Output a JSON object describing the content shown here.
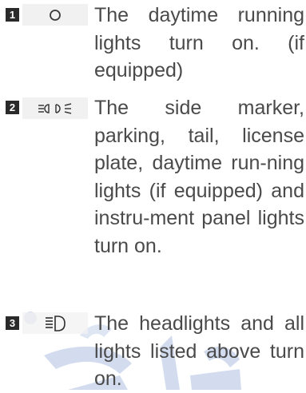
{
  "items": [
    {
      "number": "1",
      "icon": "circle-icon",
      "text": "The daytime running lights turn on. (if equipped)"
    },
    {
      "number": "2",
      "icon": "side-marker-lights-icon",
      "text": "The side marker, parking, tail, license plate, daytime run-ning lights (if equipped) and instru-ment panel lights turn on."
    },
    {
      "number": "3",
      "icon": "headlight-icon",
      "text": "The headlights and all lights listed above turn on."
    }
  ],
  "colors": {
    "text": "#4a4a4a",
    "badge": "#2a2a2a",
    "icon_box": "#f1f1f1",
    "watermark": "#c8d4ea"
  }
}
